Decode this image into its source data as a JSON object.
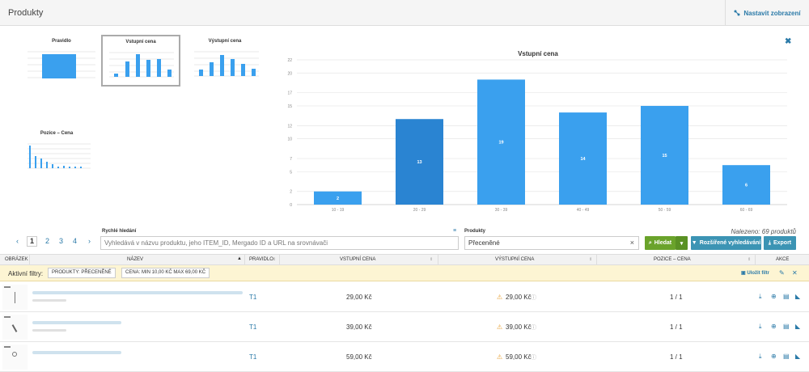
{
  "header": {
    "title": "Produkty",
    "settings_label": "Nastavit zobrazení"
  },
  "thumbs": [
    {
      "label": "Pravidlo"
    },
    {
      "label": "Vstupní cena"
    },
    {
      "label": "Výstupní cena"
    },
    {
      "label": "Pozice – Cena"
    }
  ],
  "chart_data": {
    "type": "bar",
    "title": "Vstupní cena",
    "categories": [
      "10 - 19",
      "20 - 29",
      "30 - 39",
      "40 - 49",
      "50 - 59",
      "60 - 69"
    ],
    "values": [
      2,
      13,
      19,
      14,
      15,
      6
    ],
    "ylim": [
      0,
      22
    ],
    "yticks": [
      0,
      2,
      5,
      7,
      10,
      12,
      15,
      17,
      20,
      22
    ],
    "highlighted_index": 1,
    "colors": {
      "bar": "#3aa0ee",
      "highlight": "#2a84d2"
    }
  },
  "pagination": {
    "pages": [
      "1",
      "2",
      "3",
      "4"
    ],
    "prev": "‹",
    "next": "›"
  },
  "quick_search": {
    "label": "Rychlé hledání",
    "placeholder": "Vyhledává v názvu produktu, jeho ITEM_ID, Mergado ID a URL na srovnávači"
  },
  "products_filter": {
    "label": "Produkty",
    "value": "Přeceněné",
    "clear": "×"
  },
  "buttons": {
    "search": "Hledat",
    "advanced": "Rozšířené vyhledávání",
    "export": "Export"
  },
  "found": "Nalezeno: 69 produktů",
  "table": {
    "headers": [
      "OBRÁZEK",
      "NÁZEV",
      "PRAVIDLO",
      "VSTUPNÍ CENA",
      "VÝSTUPNÍ CENA",
      "POZICE – CENA",
      "AKCE"
    ],
    "rows": [
      {
        "rule": "T1",
        "in_price": "29,00 Kč",
        "out_price": "29,00 Kč",
        "position": "1 / 1"
      },
      {
        "rule": "T1",
        "in_price": "39,00 Kč",
        "out_price": "39,00 Kč",
        "position": "1 / 1"
      },
      {
        "rule": "T1",
        "in_price": "59,00 Kč",
        "out_price": "59,00 Kč",
        "position": "1 / 1"
      }
    ]
  },
  "filters": {
    "label": "Aktivní filtry:",
    "chips": [
      "PRODUKTY: PŘECENĚNÉ",
      "CENA: MIN 10,00 KČ MAX 69,00 KČ"
    ],
    "save_label": "Uložit filtr"
  }
}
